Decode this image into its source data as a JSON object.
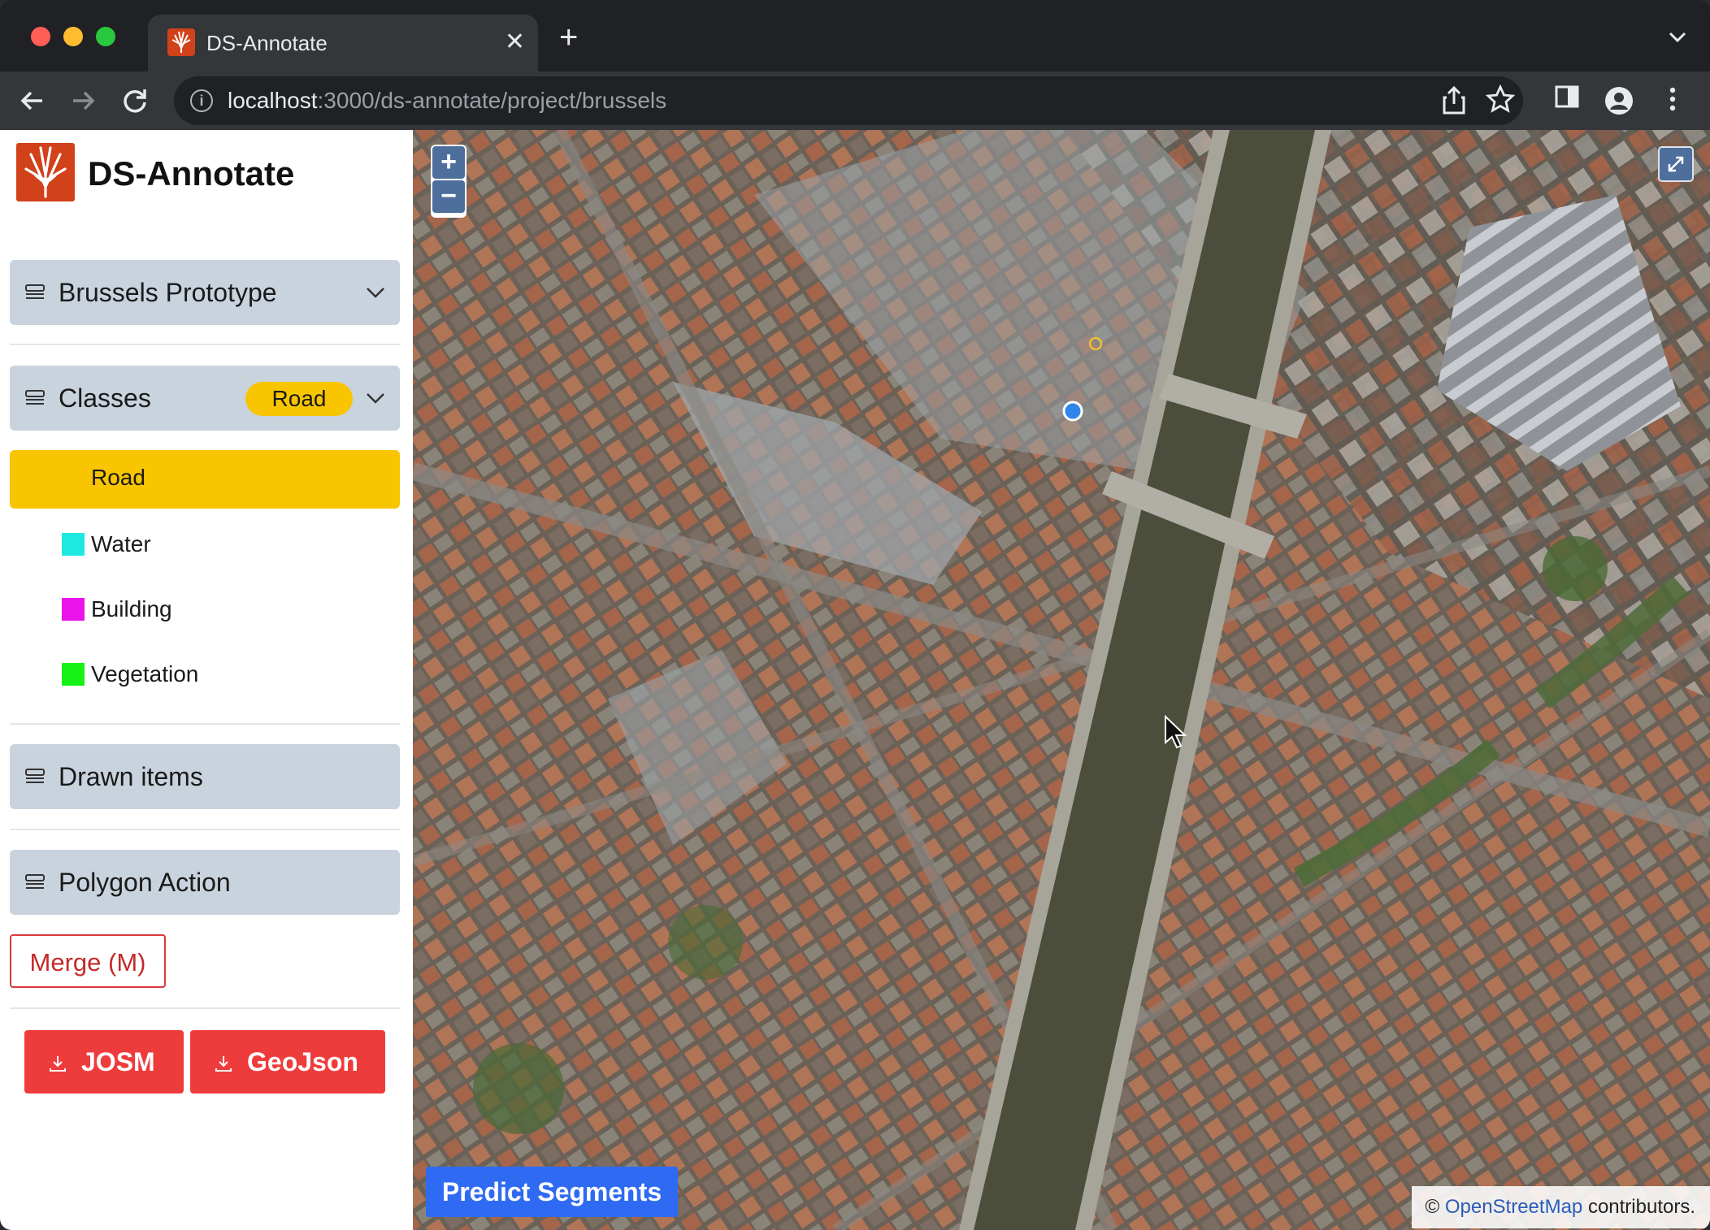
{
  "browser": {
    "tab_title": "DS-Annotate",
    "tab_close_glyph": "✕",
    "new_tab_glyph": "+",
    "url_host": "localhost",
    "url_path": ":3000/ds-annotate/project/brussels",
    "icons": [
      "back-arrow-icon",
      "forward-arrow-icon",
      "reload-icon",
      "info-icon",
      "share-icon",
      "star-icon",
      "sidebar-icon",
      "profile-icon",
      "kebab-menu-icon"
    ]
  },
  "app": {
    "title": "DS-Annotate",
    "accent_color": "#d1411a"
  },
  "sidebar": {
    "project": {
      "label": "Brussels Prototype"
    },
    "classes": {
      "label": "Classes",
      "selected_badge": "Road",
      "selected": "Road",
      "items": [
        {
          "label": "Water",
          "color": "#1de9e0"
        },
        {
          "label": "Building",
          "color": "#ea13ea"
        },
        {
          "label": "Vegetation",
          "color": "#16f216"
        }
      ],
      "selected_color": "#f8c500"
    },
    "drawn_items": {
      "label": "Drawn items"
    },
    "polygon_action": {
      "label": "Polygon Action"
    },
    "merge_button": "Merge (M)",
    "downloads": {
      "josm": "JOSM",
      "geojson": "GeoJson"
    }
  },
  "map": {
    "zoom_in": "+",
    "zoom_out": "−",
    "predict_button": "Predict Segments",
    "attribution_prefix": "©",
    "attribution_link": "OpenStreetMap",
    "attribution_suffix": "contributors."
  }
}
